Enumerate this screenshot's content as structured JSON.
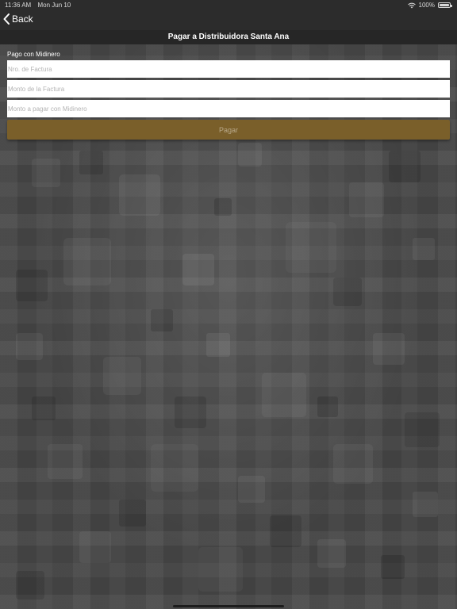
{
  "status_bar": {
    "time": "11:36 AM",
    "date": "Mon Jun 10",
    "battery_text": "100%",
    "icons": [
      "wifi-icon",
      "battery-icon"
    ]
  },
  "nav": {
    "back_label": "Back",
    "back_icon": "chevron-left-icon"
  },
  "page": {
    "title": "Pagar a Distribuidora Santa Ana"
  },
  "form": {
    "section_label": "Pago con Midinero",
    "fields": [
      {
        "placeholder": "Nro. de Factura",
        "value": ""
      },
      {
        "placeholder": "Monto de la Factura",
        "value": ""
      },
      {
        "placeholder": "Monto a pagar con Midinero",
        "value": ""
      }
    ],
    "submit_label": "Pagar"
  },
  "colors": {
    "nav_background": "#2c2c2c",
    "title_background": "#262626",
    "button_background": "#7a5f2a",
    "button_text": "#b9a98a",
    "page_background": "#3d3d3d"
  }
}
